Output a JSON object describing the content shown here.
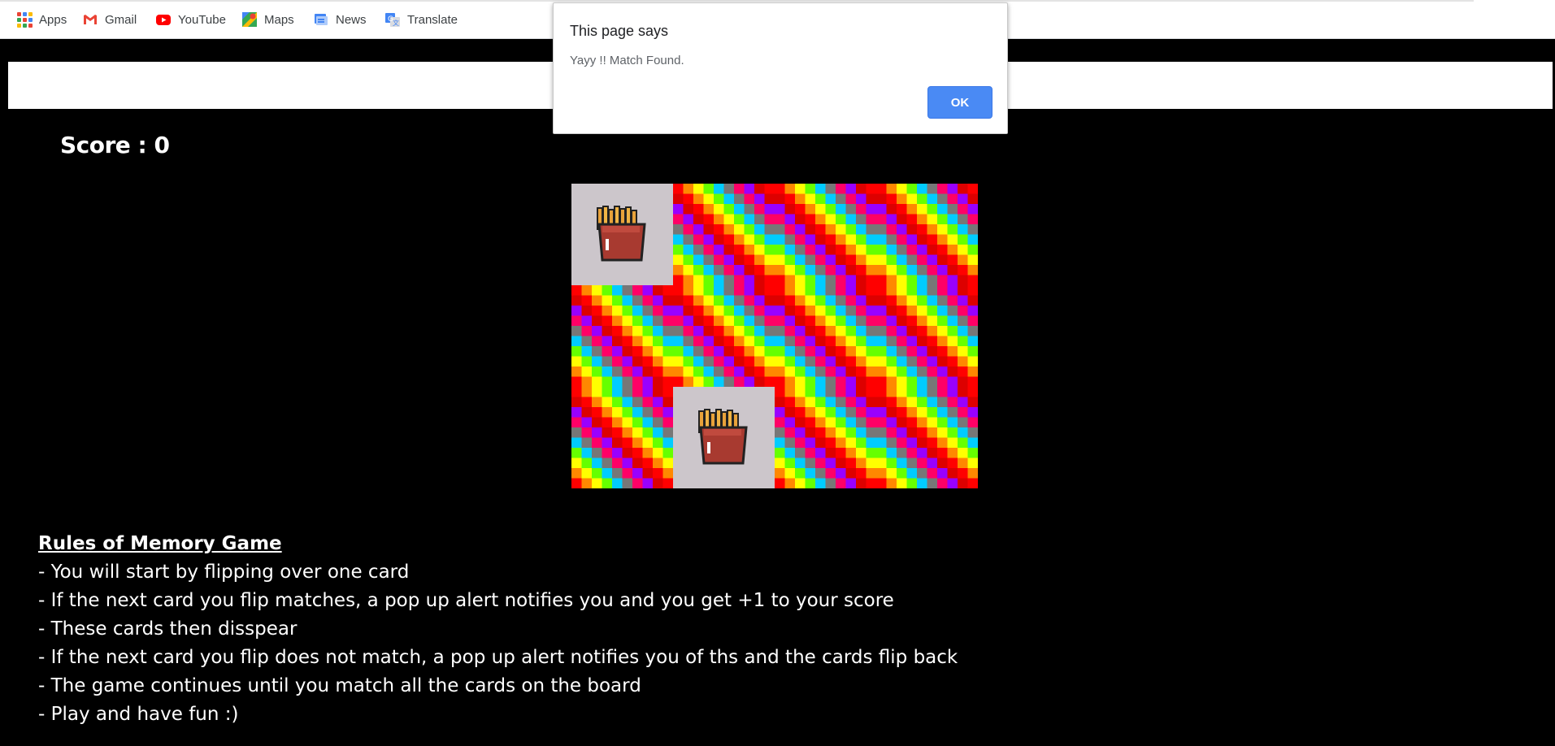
{
  "bookmarks": [
    {
      "label": "Apps",
      "icon": "apps-grid-icon"
    },
    {
      "label": "Gmail",
      "icon": "gmail-icon"
    },
    {
      "label": "YouTube",
      "icon": "youtube-icon"
    },
    {
      "label": "Maps",
      "icon": "maps-icon"
    },
    {
      "label": "News",
      "icon": "news-icon"
    },
    {
      "label": "Translate",
      "icon": "translate-icon"
    }
  ],
  "dialog": {
    "title": "This page says",
    "message": "Yayy !! Match Found.",
    "ok_label": "OK"
  },
  "score": {
    "text": "Score : 0"
  },
  "board": {
    "rows": 3,
    "cols": 4,
    "cards": [
      {
        "state": "face",
        "image": "fries-icon"
      },
      {
        "state": "back"
      },
      {
        "state": "back"
      },
      {
        "state": "back"
      },
      {
        "state": "back"
      },
      {
        "state": "back"
      },
      {
        "state": "back"
      },
      {
        "state": "back"
      },
      {
        "state": "back"
      },
      {
        "state": "face",
        "image": "fries-icon"
      },
      {
        "state": "back"
      },
      {
        "state": "back"
      }
    ],
    "back_colors": [
      "#ff0000",
      "#ff8800",
      "#ffff00",
      "#66ff00",
      "#00ccff",
      "#777777",
      "#ff0066",
      "#9900ff",
      "#dd0000"
    ]
  },
  "rules": {
    "title": "Rules of Memory Game",
    "lines": [
      "- You will start by flipping over one card",
      "- If the next card you flip matches, a pop up alert notifies you and you get +1 to your score",
      "- These cards then disspear",
      "- If the next card you flip does not match, a pop up alert notifies you of ths and the cards flip back",
      "- The game continues until you match all the cards on the board",
      "- Play and have fun :)"
    ]
  }
}
